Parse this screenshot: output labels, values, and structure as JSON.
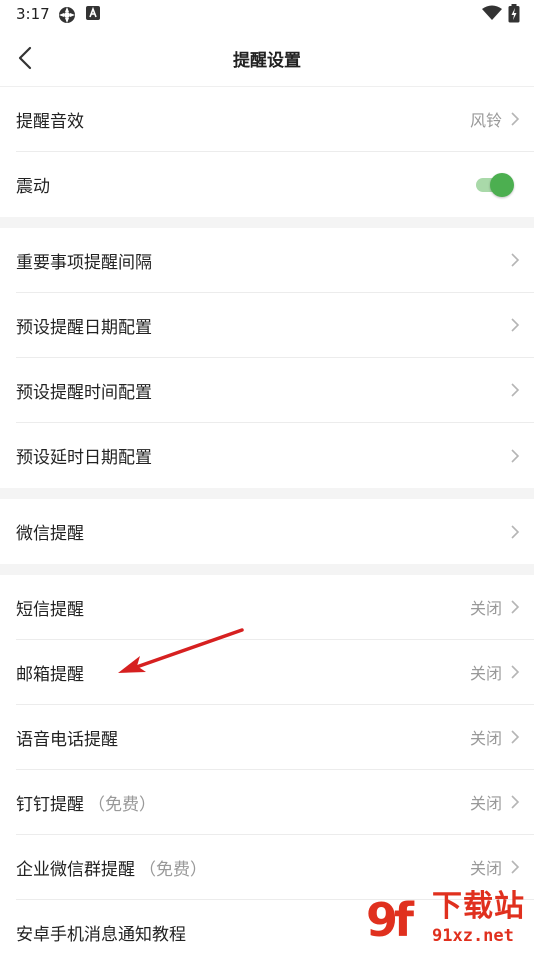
{
  "status_bar": {
    "time": "3:17"
  },
  "header": {
    "title": "提醒设置"
  },
  "groups": [
    {
      "rows": [
        {
          "label": "提醒音效",
          "value": "风铃",
          "control": "chevron"
        },
        {
          "label": "震动",
          "control": "toggle",
          "toggle_on": true
        }
      ]
    },
    {
      "rows": [
        {
          "label": "重要事项提醒间隔",
          "control": "chevron"
        },
        {
          "label": "预设提醒日期配置",
          "control": "chevron"
        },
        {
          "label": "预设提醒时间配置",
          "control": "chevron"
        },
        {
          "label": "预设延时日期配置",
          "control": "chevron"
        }
      ]
    },
    {
      "rows": [
        {
          "label": "微信提醒",
          "control": "chevron"
        }
      ]
    },
    {
      "rows": [
        {
          "label": "短信提醒",
          "value": "关闭",
          "control": "chevron"
        },
        {
          "label": "邮箱提醒",
          "value": "关闭",
          "control": "chevron"
        },
        {
          "label": "语音电话提醒",
          "value": "关闭",
          "control": "chevron"
        },
        {
          "label": "钉钉提醒",
          "suffix": "（免费）",
          "value": "关闭",
          "control": "chevron"
        },
        {
          "label": "企业微信群提醒",
          "suffix": "（免费）",
          "value": "关闭",
          "control": "chevron"
        },
        {
          "label": "安卓手机消息通知教程",
          "control": "none"
        }
      ]
    }
  ],
  "watermark": {
    "mark": "9f",
    "title": "下载站",
    "url": "91xz.net"
  },
  "colors": {
    "toggle_on": "#4caf50",
    "annotation_arrow": "#d62020",
    "watermark": "#e0301e"
  }
}
